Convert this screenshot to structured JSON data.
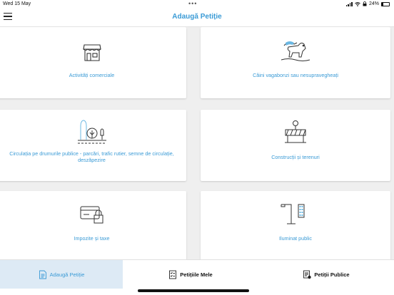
{
  "status": {
    "time": "Wed 15 May",
    "battery": "24%"
  },
  "header": {
    "title": "Adaugă Petiție"
  },
  "categories": [
    {
      "label": "Activități comerciale",
      "icon": "shop-icon"
    },
    {
      "label": "Câini vagabonzi sau nesupravegheați",
      "icon": "stray-dog-icon"
    },
    {
      "label": "Circulația pe drumurile publice - parcări, trafic rutier, semne de circulație, deszăpezire",
      "icon": "road-traffic-icon"
    },
    {
      "label": "Construcții și terenuri",
      "icon": "construction-barrier-icon"
    },
    {
      "label": "Impozite și taxe",
      "icon": "tax-card-lock-icon"
    },
    {
      "label": "Iluminat public",
      "icon": "street-light-icon"
    }
  ],
  "tabs": [
    {
      "label": "Adaugă Petiție",
      "icon": "document-add-icon",
      "active": true
    },
    {
      "label": "Petițiile Mele",
      "icon": "my-petitions-icon",
      "active": false
    },
    {
      "label": "Petiții Publice",
      "icon": "public-petitions-icon",
      "active": false
    }
  ],
  "colors": {
    "accent": "#3b9bd6",
    "active_tab_bg": "#ddeaf5",
    "background": "#efefef"
  }
}
